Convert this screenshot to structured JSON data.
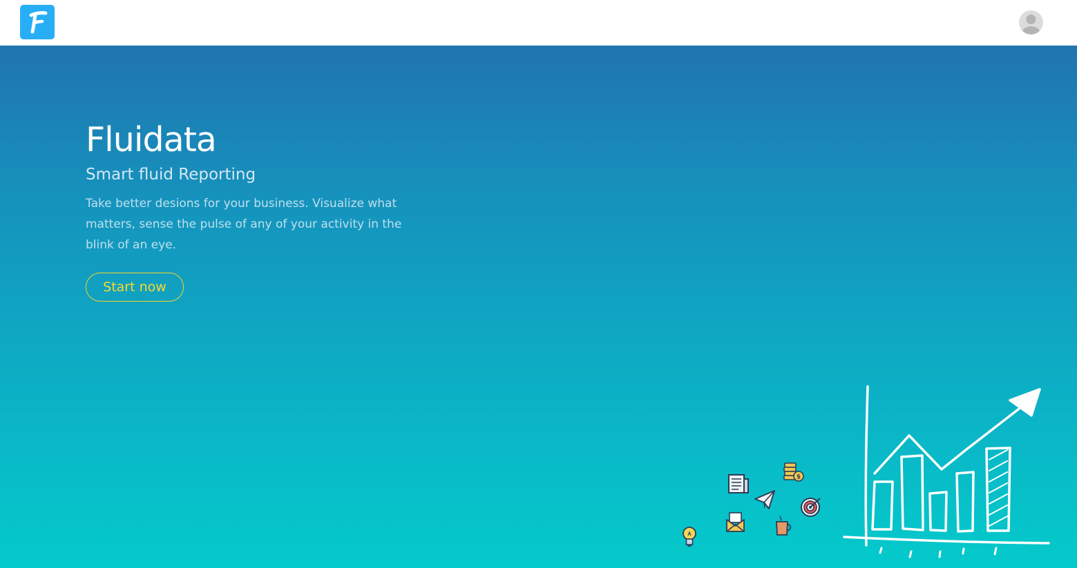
{
  "header": {
    "logo_icon": "fluidata-logo-icon",
    "logo_letter": "F",
    "logo_color": "#27aef5",
    "avatar_icon": "user-avatar-icon"
  },
  "hero": {
    "title": "Fluidata",
    "subtitle": "Smart fluid Reporting",
    "description": "Take better desions for your business. Visualize what matters, sense the pulse of any of your activity in the blink of an eye.",
    "cta_label": "Start now",
    "cta_color": "#f2d52a",
    "gradient_top": "#2174b0",
    "gradient_bottom": "#04cacb"
  },
  "illustration": {
    "icons": [
      "newspaper-icon",
      "coins-icon",
      "paper-plane-icon",
      "target-icon",
      "envelope-icon",
      "coffee-cup-icon",
      "lightbulb-icon",
      "rising-chart-icon"
    ]
  }
}
